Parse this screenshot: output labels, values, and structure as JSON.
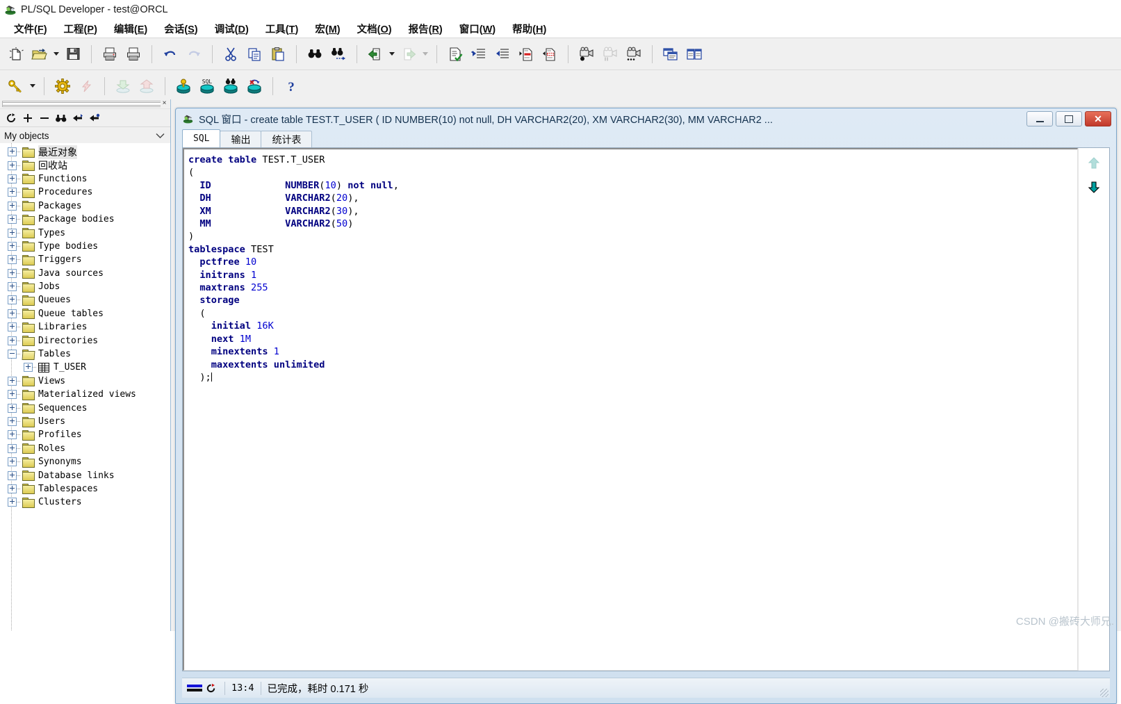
{
  "window": {
    "app_title": "PL/SQL Developer - test@ORCL",
    "app_icon": "plsql-developer-icon"
  },
  "menubar": [
    {
      "label": "文件",
      "accel": "F"
    },
    {
      "label": "工程",
      "accel": "P"
    },
    {
      "label": "编辑",
      "accel": "E"
    },
    {
      "label": "会话",
      "accel": "S"
    },
    {
      "label": "调试",
      "accel": "D"
    },
    {
      "label": "工具",
      "accel": "T"
    },
    {
      "label": "宏",
      "accel": "M"
    },
    {
      "label": "文档",
      "accel": "O"
    },
    {
      "label": "报告",
      "accel": "R"
    },
    {
      "label": "窗口",
      "accel": "W"
    },
    {
      "label": "帮助",
      "accel": "H"
    }
  ],
  "toolbar_row1": [
    {
      "name": "new-icon"
    },
    {
      "name": "open-icon",
      "dropdown": true
    },
    {
      "name": "save-icon"
    },
    {
      "sep": true
    },
    {
      "name": "print-icon"
    },
    {
      "name": "print-preview-icon"
    },
    {
      "sep": true
    },
    {
      "name": "undo-icon"
    },
    {
      "name": "redo-icon",
      "disabled": true
    },
    {
      "sep": true
    },
    {
      "name": "cut-icon"
    },
    {
      "name": "copy-icon"
    },
    {
      "name": "paste-icon"
    },
    {
      "sep": true
    },
    {
      "name": "find-icon"
    },
    {
      "name": "find-next-icon"
    },
    {
      "sep": true
    },
    {
      "name": "previous-icon",
      "dropdown": true
    },
    {
      "name": "next-icon",
      "disabled": true,
      "dropdown": true
    },
    {
      "sep": true
    },
    {
      "name": "check-syntax-icon"
    },
    {
      "name": "indent-icon"
    },
    {
      "name": "outdent-icon"
    },
    {
      "name": "comment-icon"
    },
    {
      "name": "uncomment-icon"
    },
    {
      "sep": true
    },
    {
      "name": "record-macro-icon"
    },
    {
      "name": "pause-macro-icon",
      "disabled": true
    },
    {
      "name": "play-macro-icon"
    },
    {
      "sep": true
    },
    {
      "name": "cascade-windows-icon"
    },
    {
      "name": "tile-windows-icon"
    }
  ],
  "toolbar_row2": [
    {
      "name": "key-icon",
      "dropdown": true
    },
    {
      "sep": true
    },
    {
      "name": "settings-gear-icon"
    },
    {
      "name": "break-icon",
      "disabled": true
    },
    {
      "sep": true
    },
    {
      "name": "import-icon",
      "disabled": true
    },
    {
      "name": "export-icon",
      "disabled": true
    },
    {
      "sep": true
    },
    {
      "name": "db-key-icon"
    },
    {
      "name": "db-sql-icon"
    },
    {
      "name": "db-find-icon"
    },
    {
      "name": "db-rollback-icon"
    },
    {
      "sep": true
    },
    {
      "name": "help-question-icon"
    }
  ],
  "browser": {
    "close_glyph": "×",
    "tools": [
      {
        "name": "refresh-icon"
      },
      {
        "name": "expand-all-icon"
      },
      {
        "name": "collapse-all-icon"
      },
      {
        "name": "find-object-icon"
      },
      {
        "name": "previous-object-icon"
      },
      {
        "name": "next-object-icon"
      }
    ],
    "filter": {
      "label": "My objects",
      "chevron": "chevron-down-icon"
    },
    "tree": [
      {
        "label": "最近对象",
        "cjk": true,
        "icon": "folder",
        "expanded": false,
        "selected": true
      },
      {
        "label": "回收站",
        "cjk": true,
        "icon": "folder",
        "expanded": false
      },
      {
        "label": "Functions",
        "icon": "folder",
        "expanded": false
      },
      {
        "label": "Procedures",
        "icon": "folder",
        "expanded": false
      },
      {
        "label": "Packages",
        "icon": "folder",
        "expanded": false
      },
      {
        "label": "Package bodies",
        "icon": "folder",
        "expanded": false
      },
      {
        "label": "Types",
        "icon": "folder",
        "expanded": false
      },
      {
        "label": "Type bodies",
        "icon": "folder",
        "expanded": false
      },
      {
        "label": "Triggers",
        "icon": "folder",
        "expanded": false
      },
      {
        "label": "Java sources",
        "icon": "folder",
        "expanded": false
      },
      {
        "label": "Jobs",
        "icon": "folder",
        "expanded": false
      },
      {
        "label": "Queues",
        "icon": "folder",
        "expanded": false
      },
      {
        "label": "Queue tables",
        "icon": "folder",
        "expanded": false
      },
      {
        "label": "Libraries",
        "icon": "folder",
        "expanded": false
      },
      {
        "label": "Directories",
        "icon": "folder",
        "expanded": false
      },
      {
        "label": "Tables",
        "icon": "folder-open",
        "expanded": true
      },
      {
        "label": "T_USER",
        "icon": "table",
        "child": true,
        "expanded": false
      },
      {
        "label": "Views",
        "icon": "folder",
        "expanded": false
      },
      {
        "label": "Materialized views",
        "icon": "folder",
        "expanded": false
      },
      {
        "label": "Sequences",
        "icon": "folder",
        "expanded": false
      },
      {
        "label": "Users",
        "icon": "folder",
        "expanded": false
      },
      {
        "label": "Profiles",
        "icon": "folder",
        "expanded": false
      },
      {
        "label": "Roles",
        "icon": "folder",
        "expanded": false
      },
      {
        "label": "Synonyms",
        "icon": "folder",
        "expanded": false
      },
      {
        "label": "Database links",
        "icon": "folder",
        "expanded": false
      },
      {
        "label": "Tablespaces",
        "icon": "folder",
        "expanded": false
      },
      {
        "label": "Clusters",
        "icon": "folder",
        "expanded": false
      }
    ]
  },
  "sql_window": {
    "icon": "plsql-window-icon",
    "caption": "SQL 窗口 - create table TEST.T_USER ( ID NUMBER(10) not null, DH VARCHAR2(20), XM VARCHAR2(30), MM VARCHAR2 ...",
    "buttons": {
      "minimize": "minimize-icon",
      "maximize": "maximize-icon",
      "close": "close-icon"
    },
    "tabs": [
      {
        "label": "SQL",
        "active": true,
        "mono": true
      },
      {
        "label": "输出",
        "active": false
      },
      {
        "label": "统计表",
        "active": false
      }
    ],
    "side_buttons": [
      {
        "name": "scroll-up-arrow",
        "color": "#a9d8d4",
        "enabled": false
      },
      {
        "name": "scroll-down-arrow",
        "color": "#00a0a0",
        "enabled": true
      }
    ],
    "code_lines": [
      [
        {
          "t": "create",
          "c": "k"
        },
        {
          "t": " ",
          "c": "p"
        },
        {
          "t": "table",
          "c": "k"
        },
        {
          "t": " TEST.T_USER",
          "c": "id"
        }
      ],
      [
        {
          "t": "(",
          "c": "p"
        }
      ],
      [
        {
          "t": "  ",
          "c": "p"
        },
        {
          "t": "ID",
          "c": "k"
        },
        {
          "t": "             ",
          "c": "p"
        },
        {
          "t": "NUMBER",
          "c": "k"
        },
        {
          "t": "(",
          "c": "p"
        },
        {
          "t": "10",
          "c": "n"
        },
        {
          "t": ") ",
          "c": "p"
        },
        {
          "t": "not null",
          "c": "k"
        },
        {
          "t": ",",
          "c": "p"
        }
      ],
      [
        {
          "t": "  ",
          "c": "p"
        },
        {
          "t": "DH",
          "c": "k"
        },
        {
          "t": "             ",
          "c": "p"
        },
        {
          "t": "VARCHAR2",
          "c": "k"
        },
        {
          "t": "(",
          "c": "p"
        },
        {
          "t": "20",
          "c": "n"
        },
        {
          "t": "),",
          "c": "p"
        }
      ],
      [
        {
          "t": "  ",
          "c": "p"
        },
        {
          "t": "XM",
          "c": "k"
        },
        {
          "t": "             ",
          "c": "p"
        },
        {
          "t": "VARCHAR2",
          "c": "k"
        },
        {
          "t": "(",
          "c": "p"
        },
        {
          "t": "30",
          "c": "n"
        },
        {
          "t": "),",
          "c": "p"
        }
      ],
      [
        {
          "t": "  ",
          "c": "p"
        },
        {
          "t": "MM",
          "c": "k"
        },
        {
          "t": "             ",
          "c": "p"
        },
        {
          "t": "VARCHAR2",
          "c": "k"
        },
        {
          "t": "(",
          "c": "p"
        },
        {
          "t": "50",
          "c": "n"
        },
        {
          "t": ")",
          "c": "p"
        }
      ],
      [
        {
          "t": ")",
          "c": "p"
        }
      ],
      [
        {
          "t": "tablespace",
          "c": "k"
        },
        {
          "t": " TEST",
          "c": "id"
        }
      ],
      [
        {
          "t": "  ",
          "c": "p"
        },
        {
          "t": "pctfree",
          "c": "k"
        },
        {
          "t": " ",
          "c": "p"
        },
        {
          "t": "10",
          "c": "n"
        }
      ],
      [
        {
          "t": "  ",
          "c": "p"
        },
        {
          "t": "initrans",
          "c": "k"
        },
        {
          "t": " ",
          "c": "p"
        },
        {
          "t": "1",
          "c": "n"
        }
      ],
      [
        {
          "t": "  ",
          "c": "p"
        },
        {
          "t": "maxtrans",
          "c": "k"
        },
        {
          "t": " ",
          "c": "p"
        },
        {
          "t": "255",
          "c": "n"
        }
      ],
      [
        {
          "t": "  ",
          "c": "p"
        },
        {
          "t": "storage",
          "c": "k"
        }
      ],
      [
        {
          "t": "  ",
          "c": "p"
        },
        {
          "t": "(",
          "c": "p"
        }
      ],
      [
        {
          "t": "    ",
          "c": "p"
        },
        {
          "t": "initial",
          "c": "k"
        },
        {
          "t": " ",
          "c": "p"
        },
        {
          "t": "16K",
          "c": "n"
        }
      ],
      [
        {
          "t": "    ",
          "c": "p"
        },
        {
          "t": "next",
          "c": "k"
        },
        {
          "t": " ",
          "c": "p"
        },
        {
          "t": "1M",
          "c": "n"
        }
      ],
      [
        {
          "t": "    ",
          "c": "p"
        },
        {
          "t": "minextents",
          "c": "k"
        },
        {
          "t": " ",
          "c": "p"
        },
        {
          "t": "1",
          "c": "n"
        }
      ],
      [
        {
          "t": "    ",
          "c": "p"
        },
        {
          "t": "maxextents",
          "c": "k"
        },
        {
          "t": " ",
          "c": "p"
        },
        {
          "t": "unlimited",
          "c": "k"
        }
      ],
      [
        {
          "t": "  ",
          "c": "p"
        },
        {
          "t": ");",
          "c": "p"
        }
      ]
    ],
    "statusbar": {
      "connection_icon": "connection-indicator-icon",
      "refresh_icon": "refresh-red-icon",
      "cursor_position": "13:4",
      "message": "已完成，耗时 0.171 秒"
    }
  },
  "watermark": "CSDN @搬砖大师兄.",
  "colors": {
    "keyword": "#000080",
    "number": "#0000d0",
    "window_frame": "#7ba6cc",
    "folder": "#ddcb53",
    "close_button": "#c0392b"
  }
}
